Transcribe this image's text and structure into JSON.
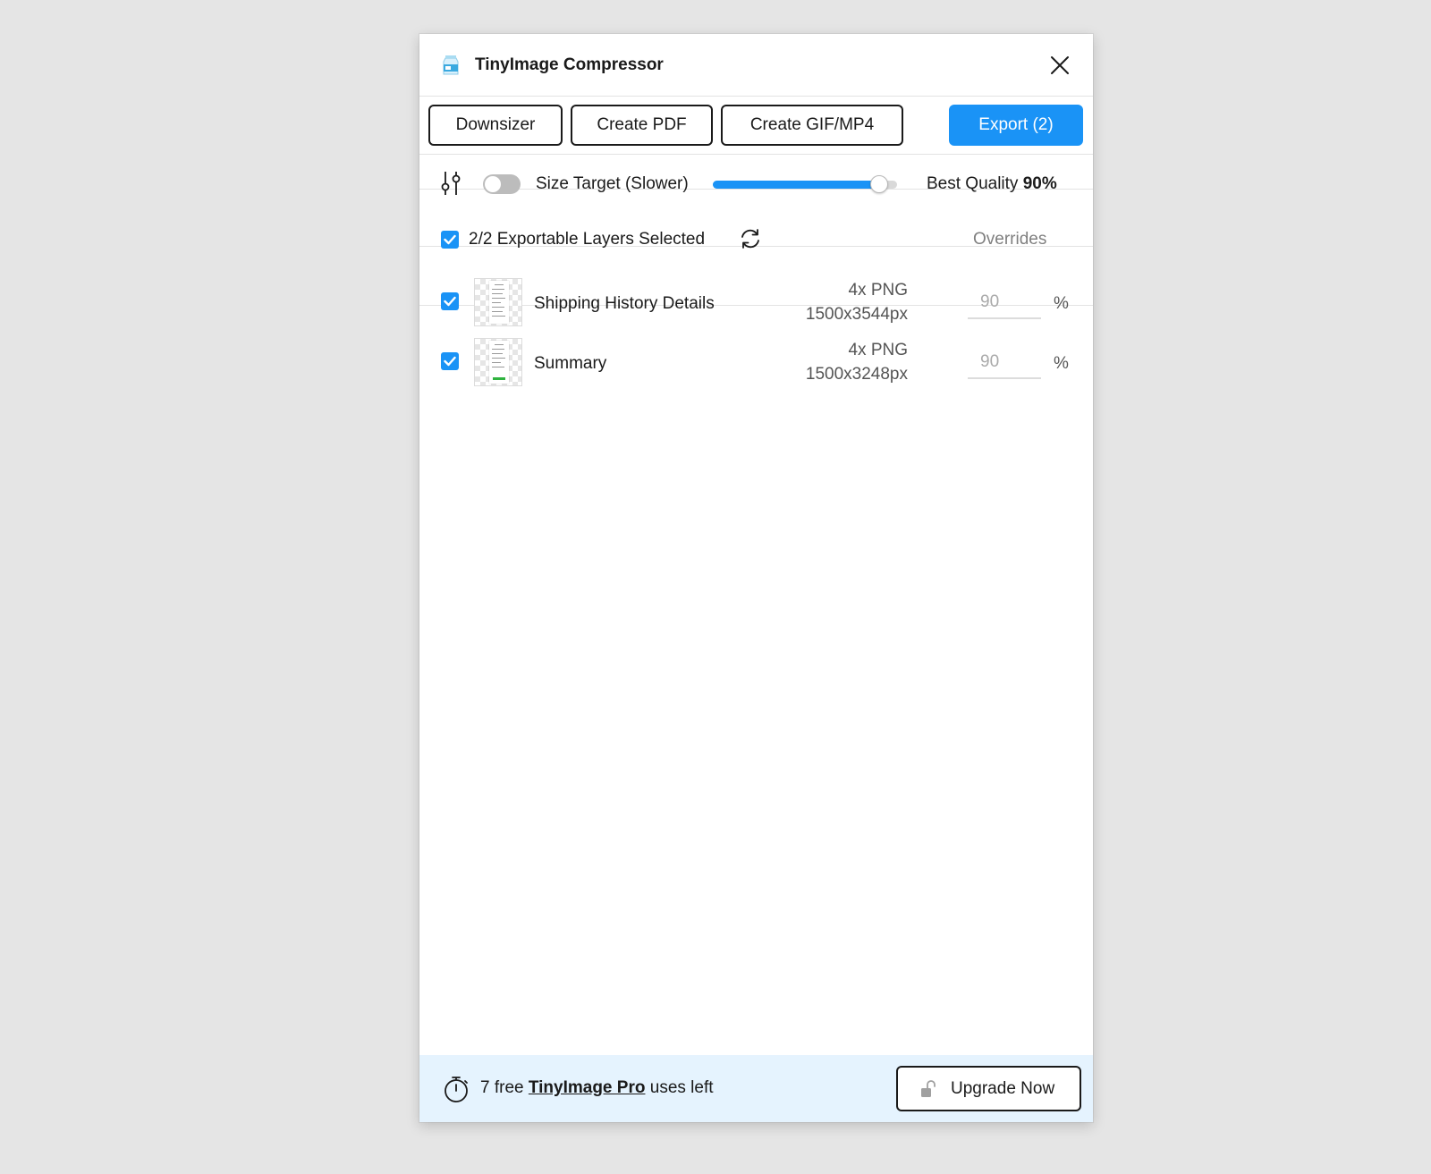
{
  "window": {
    "title": "TinyImage Compressor"
  },
  "toolbar": {
    "buttons": [
      {
        "label": "Downsizer"
      },
      {
        "label": "Create PDF"
      },
      {
        "label": "Create GIF/MP4"
      }
    ],
    "export_label": "Export (2)"
  },
  "settings": {
    "size_target_label": "Size Target (Slower)",
    "size_target_enabled": false,
    "quality_prefix": "Best Quality",
    "quality_value": "90%",
    "quality_percent": 90
  },
  "selection": {
    "label": "2/2 Exportable Layers Selected",
    "all_checked": true,
    "overrides_label": "Overrides"
  },
  "layers": [
    {
      "name": "Shipping History Details",
      "format": "4x PNG",
      "dimensions": "1500x3544px",
      "override_placeholder": "90",
      "unit": "%",
      "checked": true
    },
    {
      "name": "Summary",
      "format": "4x PNG",
      "dimensions": "1500x3248px",
      "override_placeholder": "90",
      "unit": "%",
      "checked": true
    }
  ],
  "footer": {
    "prefix": "7 free",
    "link": "TinyImage Pro",
    "suffix": "uses left",
    "upgrade_label": "Upgrade Now"
  },
  "icons": {
    "app": "milk-carton-icon",
    "close": "close-icon",
    "settings": "sliders-icon",
    "refresh": "refresh-icon",
    "timer": "stopwatch-icon",
    "lock": "unlock-icon"
  },
  "colors": {
    "accent": "#1a93f6",
    "footer_bg": "#e5f3fe",
    "thumb_progress": "#2fb33f"
  }
}
